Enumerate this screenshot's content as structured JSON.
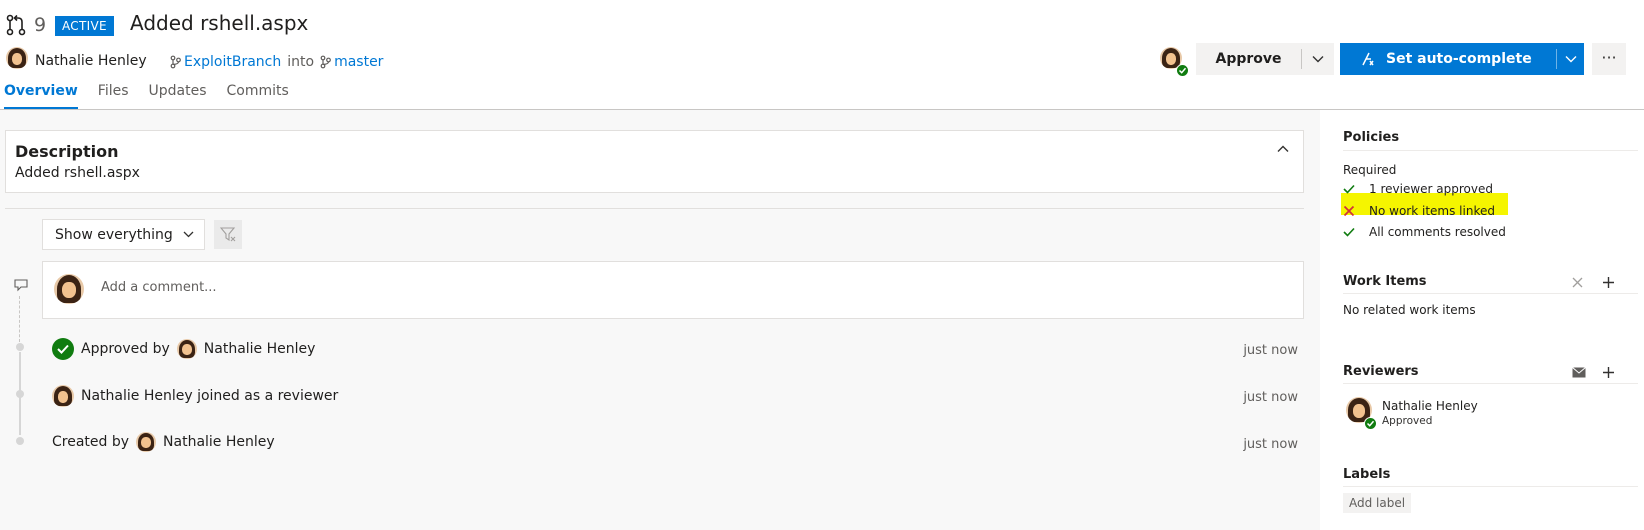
{
  "header": {
    "pr_number": "9",
    "status": "ACTIVE",
    "title": "Added rshell.aspx",
    "author": "Nathalie Henley",
    "source_branch": "ExploitBranch",
    "into_text": "into",
    "target_branch": "master"
  },
  "tabs": [
    "Overview",
    "Files",
    "Updates",
    "Commits"
  ],
  "actions": {
    "approve_label": "Approve",
    "autocomplete_label": "Set auto-complete",
    "more_label": "···"
  },
  "description": {
    "title": "Description",
    "body": "Added rshell.aspx"
  },
  "filter": {
    "label": "Show everything"
  },
  "comment": {
    "placeholder": "Add a comment..."
  },
  "timeline": [
    {
      "prefix": "Approved by",
      "user": "Nathalie Henley",
      "time": "just now"
    },
    {
      "prefix": "",
      "user": "Nathalie Henley joined as a reviewer",
      "time": "just now"
    },
    {
      "prefix": "Created by",
      "user": "Nathalie Henley",
      "time": "just now"
    }
  ],
  "policies": {
    "title": "Policies",
    "required_label": "Required",
    "items": [
      {
        "label": "1 reviewer approved",
        "status": "pass"
      },
      {
        "label": "No work items linked",
        "status": "fail"
      },
      {
        "label": "All comments resolved",
        "status": "pass"
      }
    ]
  },
  "work_items": {
    "title": "Work Items",
    "empty_text": "No related work items"
  },
  "reviewers": {
    "title": "Reviewers",
    "items": [
      {
        "name": "Nathalie Henley",
        "status": "Approved"
      }
    ]
  },
  "labels": {
    "title": "Labels",
    "add_label": "Add label"
  },
  "colors": {
    "accent": "#0078d4",
    "success": "#107c10",
    "error": "#d13438",
    "highlight": "#f5f500"
  }
}
